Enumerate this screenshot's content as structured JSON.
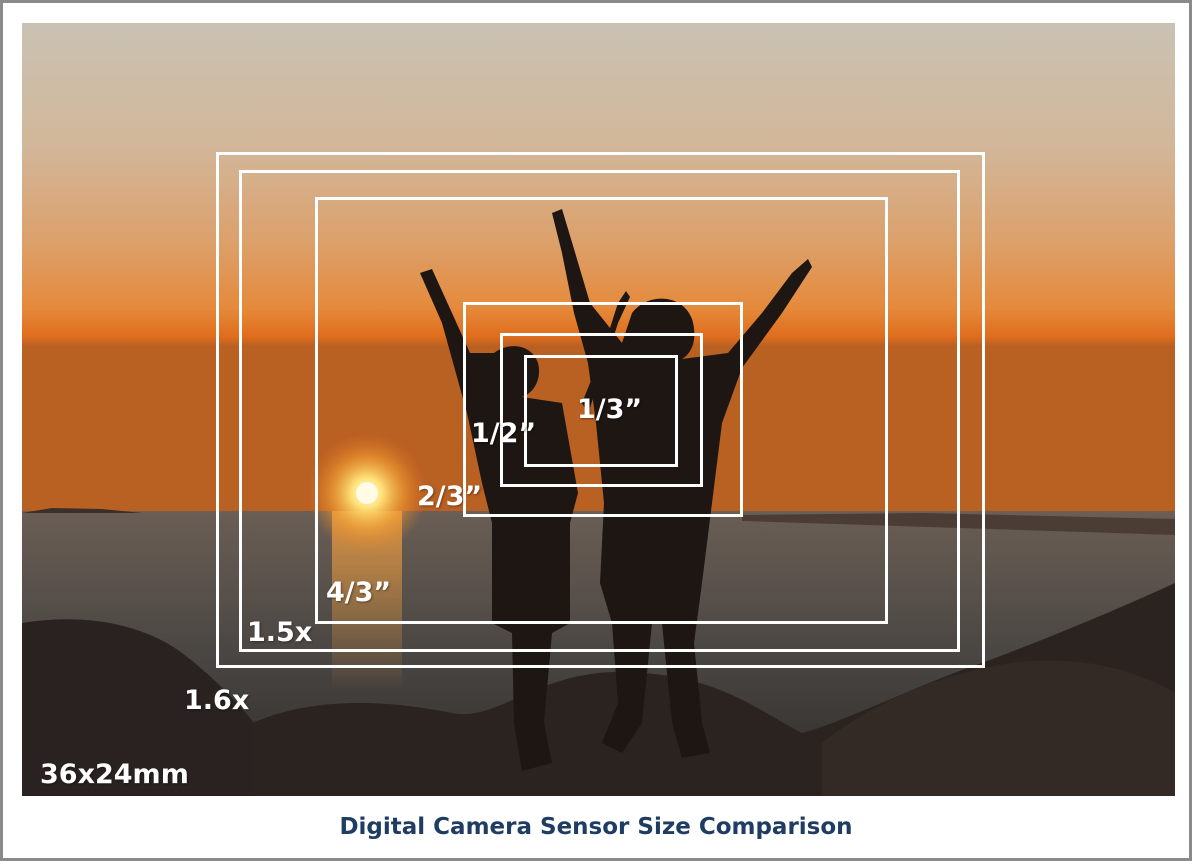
{
  "caption": "Digital Camera Sensor Size Comparison",
  "sensors": [
    {
      "label": "36x24mm"
    },
    {
      "label": "1.6x"
    },
    {
      "label": "1.5x"
    },
    {
      "label": "4/3”"
    },
    {
      "label": "2/3”"
    },
    {
      "label": "1/2”"
    },
    {
      "label": "1/3”"
    }
  ],
  "colors": {
    "caption_text": "#1f3d62",
    "frame_border": "#8a8a8a",
    "sensor_outline": "#ffffff"
  }
}
